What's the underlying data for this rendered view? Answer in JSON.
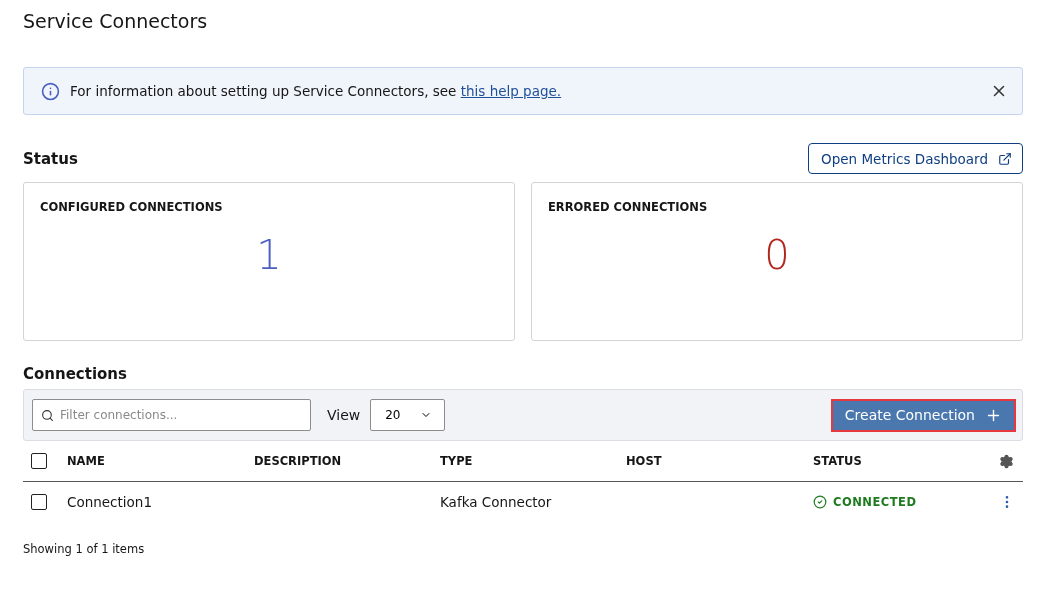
{
  "page_title": "Service Connectors",
  "banner": {
    "text": "For information about setting up Service Connectors, see ",
    "link": "this help page."
  },
  "status": {
    "heading": "Status",
    "dashboard_button": "Open Metrics Dashboard",
    "cards": [
      {
        "label": "CONFIGURED CONNECTIONS",
        "value": "1",
        "color": "#4a5fc1"
      },
      {
        "label": "ERRORED CONNECTIONS",
        "value": "0",
        "color": "#b3261e"
      }
    ]
  },
  "connections": {
    "heading": "Connections",
    "filter": {
      "placeholder": "Filter connections..."
    },
    "view_label": "View",
    "view_value": "20",
    "create_button": {
      "label": "Create Connection",
      "highlighted": true
    },
    "columns": [
      "NAME",
      "DESCRIPTION",
      "TYPE",
      "HOST",
      "STATUS"
    ],
    "select_all": {
      "checked": false
    },
    "rows": [
      {
        "checked": false,
        "name": "Connection1",
        "description": "",
        "type": "Kafka Connector",
        "host": "",
        "status": {
          "kind": "connected",
          "label": "CONNECTED"
        }
      }
    ],
    "footer": "Showing 1 of 1 items"
  }
}
